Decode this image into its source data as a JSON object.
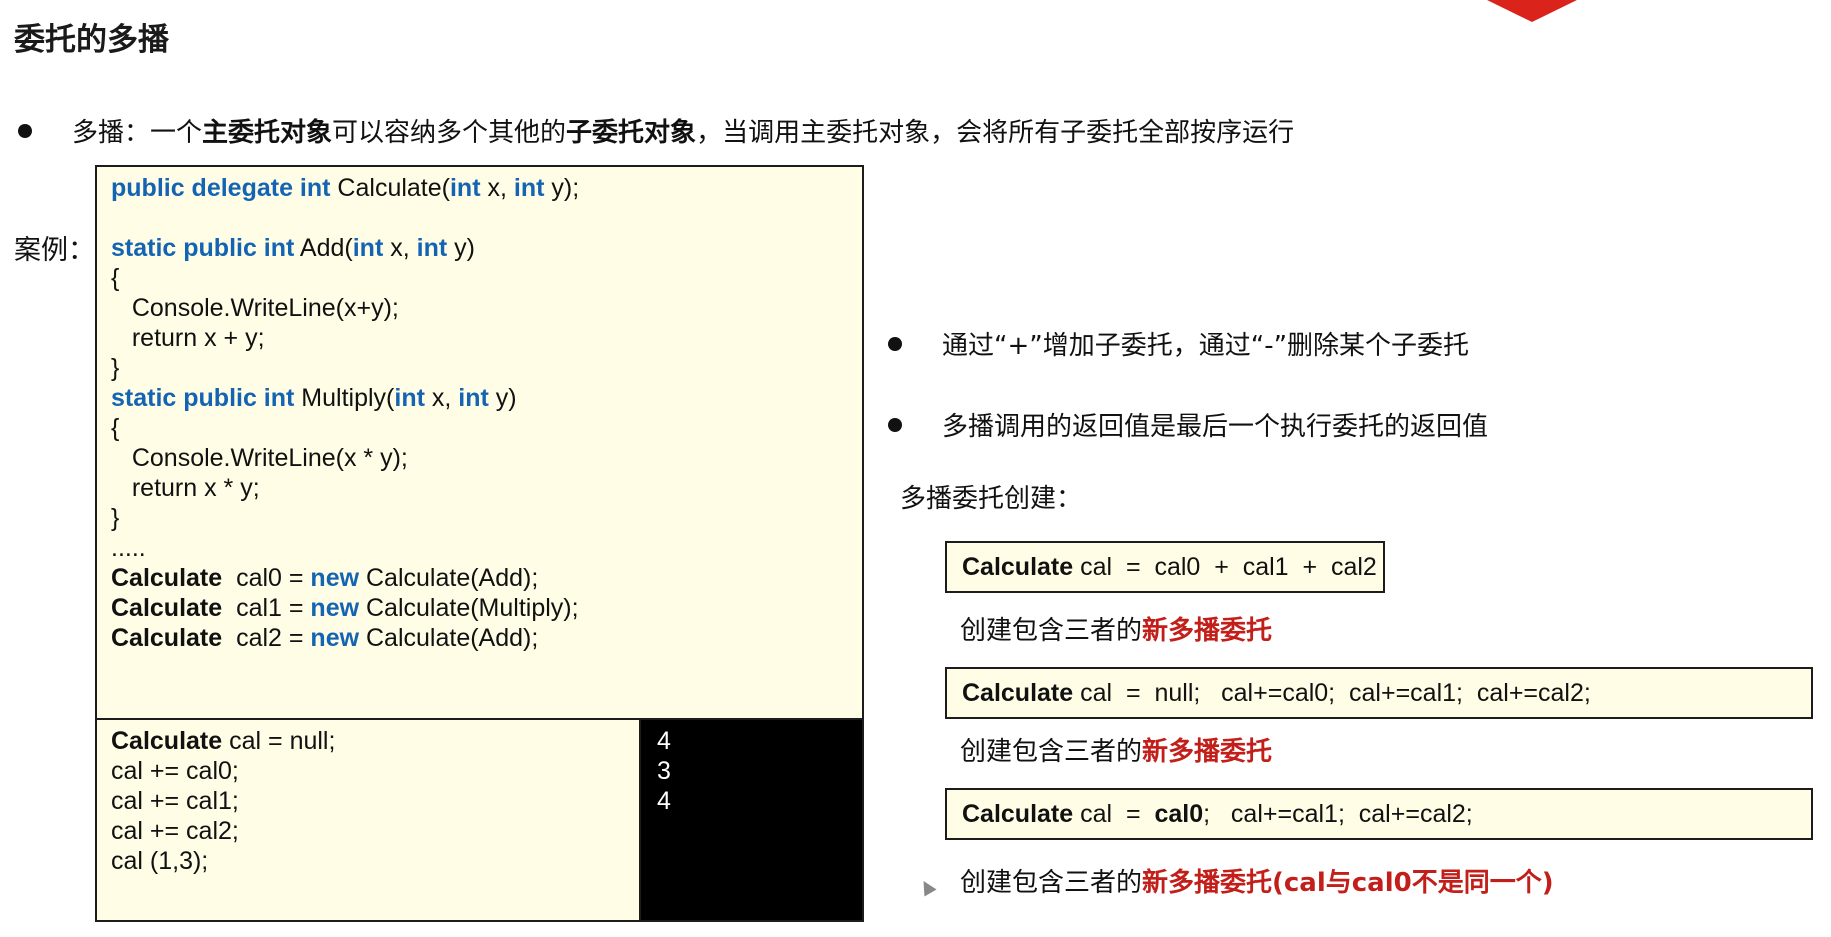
{
  "title": "委托的多播",
  "bullet1": {
    "prefix": "多播：一个",
    "bold1": "主委托对象",
    "mid": "可以容纳多个其他的",
    "bold2": "子委托对象",
    "suffix": "，当调用主委托对象，会将所有子委托全部按序运行"
  },
  "case_label": "案例：",
  "code_top": [
    [
      {
        "t": "public delegate int",
        "c": "kw"
      },
      {
        "t": " Calculate("
      },
      {
        "t": "int",
        "c": "kw"
      },
      {
        "t": " x, "
      },
      {
        "t": "int",
        "c": "kw"
      },
      {
        "t": " y);"
      }
    ],
    [],
    [
      {
        "t": "static public int",
        "c": "kw"
      },
      {
        "t": " Add("
      },
      {
        "t": "int",
        "c": "kw"
      },
      {
        "t": " x, "
      },
      {
        "t": "int",
        "c": "kw"
      },
      {
        "t": " y)"
      }
    ],
    [
      {
        "t": "{"
      }
    ],
    [
      {
        "t": "   Console.WriteLine(x+y);"
      }
    ],
    [
      {
        "t": "   return x + y;"
      }
    ],
    [
      {
        "t": "}"
      }
    ],
    [
      {
        "t": "static public int",
        "c": "kw"
      },
      {
        "t": " Multiply("
      },
      {
        "t": "int",
        "c": "kw"
      },
      {
        "t": " x, "
      },
      {
        "t": "int",
        "c": "kw"
      },
      {
        "t": " y)"
      }
    ],
    [
      {
        "t": "{"
      }
    ],
    [
      {
        "t": "   Console.WriteLine(x * y);"
      }
    ],
    [
      {
        "t": "   return x * y;"
      }
    ],
    [
      {
        "t": "}"
      }
    ],
    [
      {
        "t": "....."
      }
    ],
    [
      {
        "t": "Calculate",
        "c": "b"
      },
      {
        "t": "  cal0 = "
      },
      {
        "t": "new",
        "c": "kw"
      },
      {
        "t": " Calculate(Add);"
      }
    ],
    [
      {
        "t": "Calculate",
        "c": "b"
      },
      {
        "t": "  cal1 = "
      },
      {
        "t": "new",
        "c": "kw"
      },
      {
        "t": " Calculate(Multiply);"
      }
    ],
    [
      {
        "t": "Calculate",
        "c": "b"
      },
      {
        "t": "  cal2 = "
      },
      {
        "t": "new",
        "c": "kw"
      },
      {
        "t": " Calculate(Add);"
      }
    ]
  ],
  "code_bottom": [
    [
      {
        "t": "Calculate",
        "c": "b"
      },
      {
        "t": " cal = null;"
      }
    ],
    [
      {
        "t": "cal += cal0;"
      }
    ],
    [
      {
        "t": "cal += cal1;"
      }
    ],
    [
      {
        "t": "cal += cal2;"
      }
    ],
    [
      {
        "t": "cal (1,3);"
      }
    ]
  ],
  "console_output": [
    "4",
    "3",
    "4"
  ],
  "bullet2": "通过“+”增加子委托，通过“-”删除某个子委托",
  "bullet3": "多播调用的返回值是最后一个执行委托的返回值",
  "creation_label": "多播委托创建：",
  "snippet1": [
    {
      "t": "Calculate",
      "c": "b"
    },
    {
      "t": " cal  =  cal0  +  cal1  +  cal2"
    }
  ],
  "caption1": {
    "plain": "创建包含三者的",
    "red": "新多播委托"
  },
  "snippet2": [
    {
      "t": "Calculate",
      "c": "b"
    },
    {
      "t": " cal  =  null;   cal+=cal0;  cal+=cal1;  cal+=cal2;"
    }
  ],
  "caption2": {
    "plain": "创建包含三者的",
    "red": "新多播委托"
  },
  "snippet3": [
    {
      "t": "Calculate",
      "c": "b"
    },
    {
      "t": " cal  =  "
    },
    {
      "t": "cal0",
      "c": "b"
    },
    {
      "t": ";   cal+=cal1;  cal+=cal2;"
    }
  ],
  "caption3": {
    "plain": "创建包含三者的",
    "red": "新多播委托(cal与cal0不是同一个)"
  },
  "colors": {
    "keyword": "#1464b4",
    "highlight": "#c21f1a",
    "code_bg": "#fffde6"
  }
}
